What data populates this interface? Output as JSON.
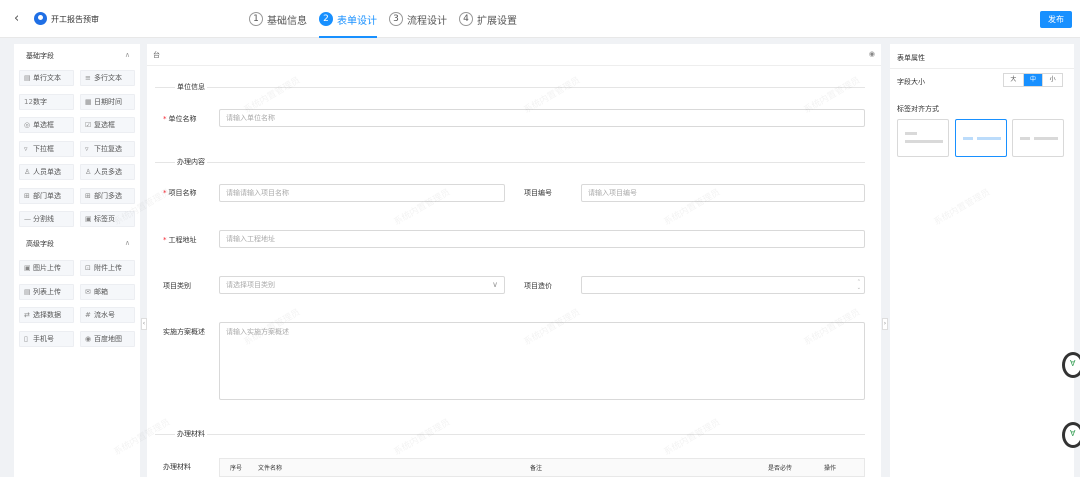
{
  "header": {
    "back_icon": "‹",
    "title": "开工报告预审",
    "steps": [
      {
        "num": "1",
        "label": "基础信息"
      },
      {
        "num": "2",
        "label": "表单设计"
      },
      {
        "num": "3",
        "label": "流程设计"
      },
      {
        "num": "4",
        "label": "扩展设置"
      }
    ],
    "active_step": 2,
    "publish_label": "发布"
  },
  "left": {
    "basic_title": "基础字段",
    "advanced_title": "高级字段",
    "chevron": "∧",
    "basic_items": [
      {
        "icon": "▤",
        "label": "单行文本"
      },
      {
        "icon": "≡",
        "label": "多行文本"
      },
      {
        "icon": "12",
        "label": "数字"
      },
      {
        "icon": "▦",
        "label": "日期时间"
      },
      {
        "icon": "◎",
        "label": "单选框"
      },
      {
        "icon": "☑",
        "label": "复选框"
      },
      {
        "icon": "▿",
        "label": "下拉框"
      },
      {
        "icon": "▿",
        "label": "下拉复选"
      },
      {
        "icon": "♙",
        "label": "人员单选"
      },
      {
        "icon": "♙",
        "label": "人员多选"
      },
      {
        "icon": "⊞",
        "label": "部门单选"
      },
      {
        "icon": "⊞",
        "label": "部门多选"
      },
      {
        "icon": "—",
        "label": "分割线"
      },
      {
        "icon": "▣",
        "label": "标签页"
      }
    ],
    "advanced_items": [
      {
        "icon": "▣",
        "label": "图片上传"
      },
      {
        "icon": "⊡",
        "label": "附件上传"
      },
      {
        "icon": "▤",
        "label": "列表上传"
      },
      {
        "icon": "✉",
        "label": "邮箱"
      },
      {
        "icon": "⇄",
        "label": "选择数据"
      },
      {
        "icon": "#",
        "label": "流水号"
      },
      {
        "icon": "▯",
        "label": "手机号"
      },
      {
        "icon": "◉",
        "label": "百度地图"
      }
    ]
  },
  "canvas": {
    "toolbar_left": "台",
    "toolbar_right": "◉",
    "sections": {
      "unit": "单位信息",
      "handle": "办理内容",
      "material": "办理材料"
    },
    "fields": {
      "unit_name": {
        "label": "单位名称",
        "placeholder": "请输入单位名称"
      },
      "project_name": {
        "label": "项目名称",
        "placeholder": "请输请输入项目名称"
      },
      "project_no": {
        "label": "项目编号",
        "placeholder": "请输入项目编号"
      },
      "address": {
        "label": "工程地址",
        "placeholder": "请输入工程地址"
      },
      "category": {
        "label": "项目类别",
        "placeholder": "请选择项目类别",
        "suffix": "∨"
      },
      "cost": {
        "label": "项目造价",
        "placeholder": ""
      },
      "plan": {
        "label": "实施方案概述",
        "placeholder": "请输入实施方案概述"
      },
      "materials": {
        "label": "办理材料"
      }
    },
    "table_headers": [
      "序号",
      "文件名称",
      "备注",
      "是否必传",
      "操作"
    ]
  },
  "right": {
    "title": "表单属性",
    "size_label": "字段大小",
    "sizes": [
      "大",
      "中",
      "小"
    ],
    "active_size": 1,
    "align_label": "标签对齐方式"
  },
  "collapse_left": "‹",
  "collapse_right": "›",
  "watermark": "系统内置管理员",
  "float_icon": "∀",
  "colors": {
    "primary": "#1890ff",
    "required": "#f5222d"
  }
}
